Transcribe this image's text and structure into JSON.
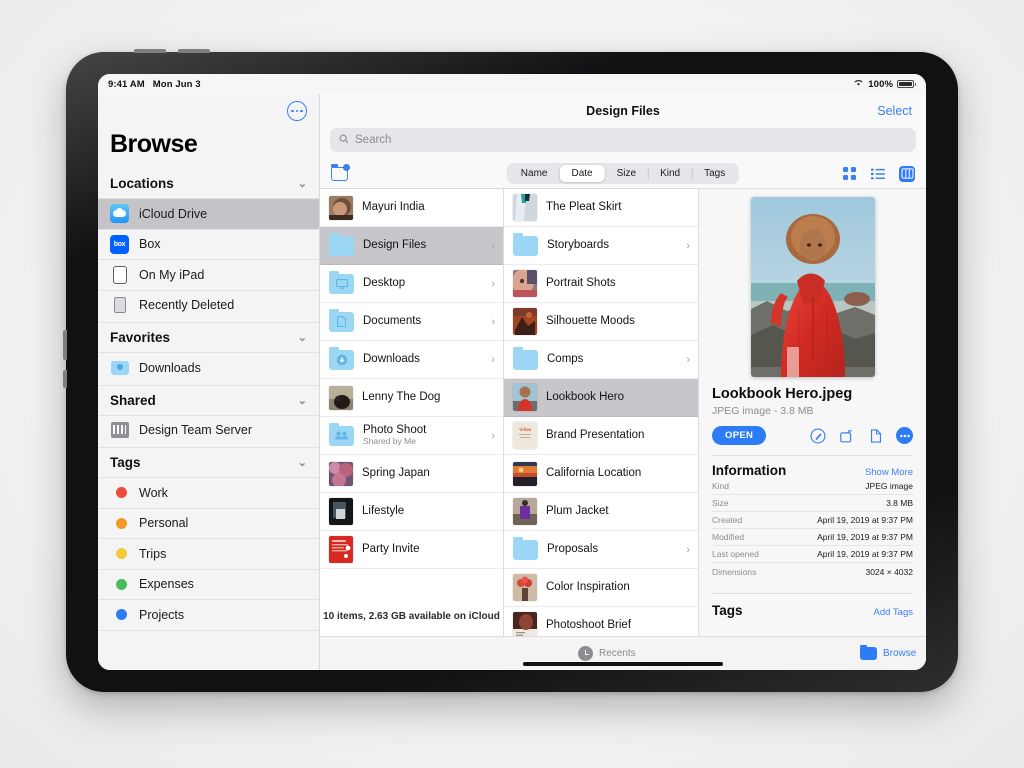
{
  "status_bar": {
    "time": "9:41 AM",
    "date": "Mon Jun 3",
    "battery": "100%",
    "wifi_icon": "wifi-icon"
  },
  "sidebar": {
    "title": "Browse",
    "more_icon": "more-circle-icon",
    "sections": [
      {
        "label": "Locations",
        "items": [
          {
            "label": "iCloud Drive",
            "icon": "icloud-drive-icon",
            "selected": true
          },
          {
            "label": "Box",
            "icon": "box-icon",
            "selected": false
          },
          {
            "label": "On My iPad",
            "icon": "ipad-icon",
            "selected": false
          },
          {
            "label": "Recently Deleted",
            "icon": "trash-icon",
            "selected": false
          }
        ]
      },
      {
        "label": "Favorites",
        "items": [
          {
            "label": "Downloads",
            "icon": "downloads-folder-icon",
            "selected": false
          }
        ]
      },
      {
        "label": "Shared",
        "items": [
          {
            "label": "Design Team Server",
            "icon": "server-icon",
            "selected": false
          }
        ]
      },
      {
        "label": "Tags",
        "items": [
          {
            "label": "Work",
            "icon": "tag-dot-icon",
            "color": "#eb4b3c",
            "selected": false
          },
          {
            "label": "Personal",
            "icon": "tag-dot-icon",
            "color": "#f09a25",
            "selected": false
          },
          {
            "label": "Trips",
            "icon": "tag-dot-icon",
            "color": "#f6c93b",
            "selected": false
          },
          {
            "label": "Expenses",
            "icon": "tag-dot-icon",
            "color": "#4cbb5a",
            "selected": false
          },
          {
            "label": "Projects",
            "icon": "tag-dot-icon",
            "color": "#2d7cf6",
            "selected": false
          }
        ]
      }
    ]
  },
  "nav": {
    "title": "Design Files",
    "select_label": "Select"
  },
  "search": {
    "placeholder": "Search",
    "value": "",
    "icon": "search-icon"
  },
  "toolbar": {
    "new_folder_icon": "new-folder-icon",
    "sort_options": [
      {
        "label": "Name",
        "active": false
      },
      {
        "label": "Date",
        "active": true
      },
      {
        "label": "Size",
        "active": false
      },
      {
        "label": "Kind",
        "active": false
      },
      {
        "label": "Tags",
        "active": false
      }
    ],
    "views": [
      {
        "icon": "grid-view-icon",
        "active": false
      },
      {
        "icon": "list-view-icon",
        "active": false
      },
      {
        "icon": "column-view-icon",
        "active": true
      }
    ]
  },
  "column_one": {
    "items": [
      {
        "name": "Mayuri India",
        "type": "image",
        "arrow": false,
        "selected": false,
        "sub": ""
      },
      {
        "name": "Design Files",
        "type": "folder",
        "arrow": true,
        "selected": true,
        "sub": ""
      },
      {
        "name": "Desktop",
        "type": "folder-desktop",
        "arrow": true,
        "selected": false,
        "sub": ""
      },
      {
        "name": "Documents",
        "type": "folder-documents",
        "arrow": true,
        "selected": false,
        "sub": ""
      },
      {
        "name": "Downloads",
        "type": "folder-downloads",
        "arrow": true,
        "selected": false,
        "sub": ""
      },
      {
        "name": "Lenny The Dog",
        "type": "image",
        "arrow": false,
        "selected": false,
        "sub": ""
      },
      {
        "name": "Photo Shoot",
        "type": "folder-shared",
        "arrow": true,
        "selected": false,
        "sub": "Shared by Me"
      },
      {
        "name": "Spring Japan",
        "type": "image",
        "arrow": false,
        "selected": false,
        "sub": ""
      },
      {
        "name": "Lifestyle",
        "type": "image",
        "arrow": false,
        "selected": false,
        "sub": ""
      },
      {
        "name": "Party Invite",
        "type": "image",
        "arrow": false,
        "selected": false,
        "sub": ""
      }
    ],
    "footer": "10 items, 2.63 GB available on iCloud"
  },
  "column_two": {
    "items": [
      {
        "name": "The Pleat Skirt",
        "type": "image",
        "arrow": false,
        "selected": false
      },
      {
        "name": "Storyboards",
        "type": "folder",
        "arrow": true,
        "selected": false
      },
      {
        "name": "Portrait Shots",
        "type": "image",
        "arrow": false,
        "selected": false
      },
      {
        "name": "Silhouette Moods",
        "type": "image",
        "arrow": false,
        "selected": false
      },
      {
        "name": "Comps",
        "type": "folder",
        "arrow": true,
        "selected": false
      },
      {
        "name": "Lookbook Hero",
        "type": "image",
        "arrow": false,
        "selected": true
      },
      {
        "name": "Brand Presentation",
        "type": "image",
        "arrow": false,
        "selected": false
      },
      {
        "name": "California Location",
        "type": "image",
        "arrow": false,
        "selected": false
      },
      {
        "name": "Plum Jacket",
        "type": "image",
        "arrow": false,
        "selected": false
      },
      {
        "name": "Proposals",
        "type": "folder",
        "arrow": true,
        "selected": false
      },
      {
        "name": "Color Inspiration",
        "type": "image",
        "arrow": false,
        "selected": false
      },
      {
        "name": "Photoshoot Brief",
        "type": "image",
        "arrow": false,
        "selected": false
      }
    ]
  },
  "inspector": {
    "preview_alt": "lookbook-hero-preview",
    "file_name": "Lookbook Hero.jpeg",
    "file_meta": "JPEG image - 3.8 MB",
    "open_label": "OPEN",
    "action_icons": [
      {
        "icon": "markup-icon"
      },
      {
        "icon": "rotate-icon"
      },
      {
        "icon": "duplicate-icon"
      },
      {
        "icon": "more-icon"
      }
    ],
    "information": {
      "heading": "Information",
      "show_more": "Show More",
      "rows": [
        {
          "key": "Kind",
          "value": "JPEG image"
        },
        {
          "key": "Size",
          "value": "3.8 MB"
        },
        {
          "key": "Created",
          "value": "April 19, 2019 at 9:37 PM"
        },
        {
          "key": "Modified",
          "value": "April 19, 2019 at 9:37 PM"
        },
        {
          "key": "Last opened",
          "value": "April 19, 2019 at 9:37 PM"
        },
        {
          "key": "Dimensions",
          "value": "3024 × 4032"
        }
      ]
    },
    "tags": {
      "heading": "Tags",
      "add_label": "Add Tags"
    }
  },
  "tabbar": {
    "tabs": [
      {
        "label": "Recents",
        "icon": "clock-icon",
        "active": false
      },
      {
        "label": "Browse",
        "icon": "folder-icon",
        "active": true
      }
    ]
  },
  "colors": {
    "accent": "#2d7cf6",
    "link": "#3b7ff5",
    "sidebar_bg": "#f4f4f5",
    "selection": "#c6c6cb"
  }
}
